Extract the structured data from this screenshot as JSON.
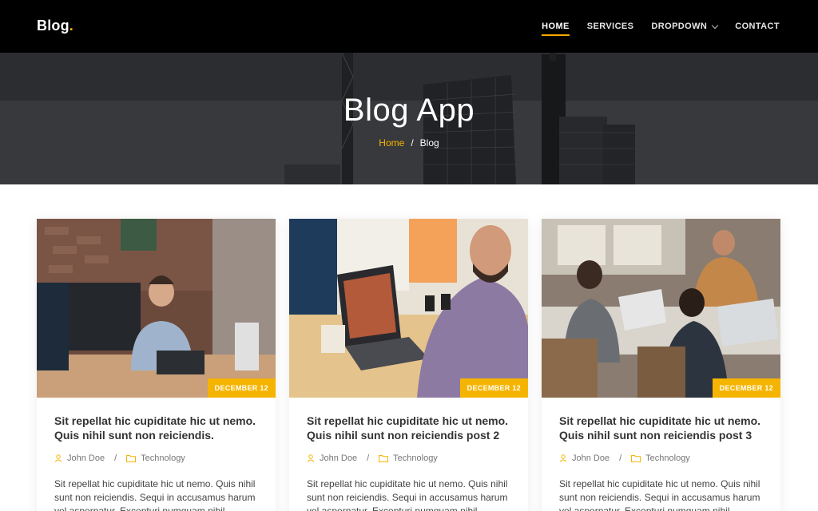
{
  "header": {
    "logo": "Blog",
    "logo_dot": ".",
    "nav": [
      {
        "label": "HOME"
      },
      {
        "label": "SERVICES"
      },
      {
        "label": "DROPDOWN"
      },
      {
        "label": "CONTACT"
      }
    ]
  },
  "hero": {
    "title": "Blog App",
    "breadcrumb_home": "Home",
    "breadcrumb_sep": "/",
    "breadcrumb_current": "Blog"
  },
  "colors": {
    "accent": "#f5b400",
    "header_bg": "#000000"
  },
  "posts": [
    {
      "date": "DECEMBER 12",
      "title": "Sit repellat hic cupiditate hic ut nemo. Quis nihil sunt non reiciendis.",
      "author": "John Doe",
      "category": "Technology",
      "excerpt": "Sit repellat hic cupiditate hic ut nemo. Quis nihil sunt non reiciendis. Sequi in accusamus harum vel aspernatur. Excepturi numquam nihil"
    },
    {
      "date": "DECEMBER 12",
      "title": "Sit repellat hic cupiditate hic ut nemo. Quis nihil sunt non reiciendis post 2",
      "author": "John Doe",
      "category": "Technology",
      "excerpt": "Sit repellat hic cupiditate hic ut nemo. Quis nihil sunt non reiciendis. Sequi in accusamus harum vel aspernatur. Excepturi numquam nihil"
    },
    {
      "date": "DECEMBER 12",
      "title": "Sit repellat hic cupiditate hic ut nemo. Quis nihil sunt non reiciendis post 3",
      "author": "John Doe",
      "category": "Technology",
      "excerpt": "Sit repellat hic cupiditate hic ut nemo. Quis nihil sunt non reiciendis. Sequi in accusamus harum vel aspernatur. Excepturi numquam nihil"
    }
  ]
}
